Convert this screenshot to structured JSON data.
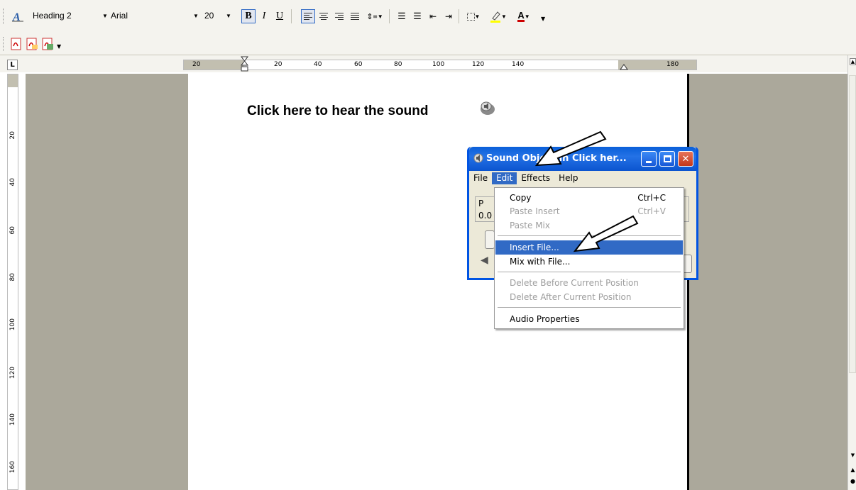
{
  "toolbar": {
    "style": "Heading 2",
    "font": "Arial",
    "size": "20",
    "bold": "B",
    "italic": "I",
    "underline": "U",
    "font_color_letter": "A"
  },
  "ruler": {
    "h_labels": [
      "20",
      "20",
      "40",
      "60",
      "80",
      "100",
      "120",
      "140",
      "180"
    ],
    "v_labels": [
      "20",
      "40",
      "60",
      "80",
      "100",
      "120",
      "140",
      "160"
    ],
    "corner": "L"
  },
  "document": {
    "heading": "Click here to hear the sound"
  },
  "sound_window": {
    "title": "Sound Object in Click her...",
    "menu": [
      "File",
      "Edit",
      "Effects",
      "Help"
    ],
    "active_menu": "Edit",
    "body_line1": "P",
    "body_line2": "0.0"
  },
  "edit_menu": {
    "items": [
      {
        "label": "Copy",
        "shortcut": "Ctrl+C",
        "state": "enabled"
      },
      {
        "label": "Paste Insert",
        "shortcut": "Ctrl+V",
        "state": "disabled"
      },
      {
        "label": "Paste Mix",
        "shortcut": "",
        "state": "disabled"
      },
      {
        "label": "Insert File...",
        "shortcut": "",
        "state": "highlighted"
      },
      {
        "label": "Mix with File...",
        "shortcut": "",
        "state": "enabled"
      },
      {
        "label": "Delete Before Current Position",
        "shortcut": "",
        "state": "disabled"
      },
      {
        "label": "Delete After Current Position",
        "shortcut": "",
        "state": "disabled"
      },
      {
        "label": "Audio Properties",
        "shortcut": "",
        "state": "enabled"
      }
    ]
  },
  "colors": {
    "title_bar": "#0a5fd8",
    "highlight": "#316ac5",
    "doc_background": "#aba89b"
  }
}
